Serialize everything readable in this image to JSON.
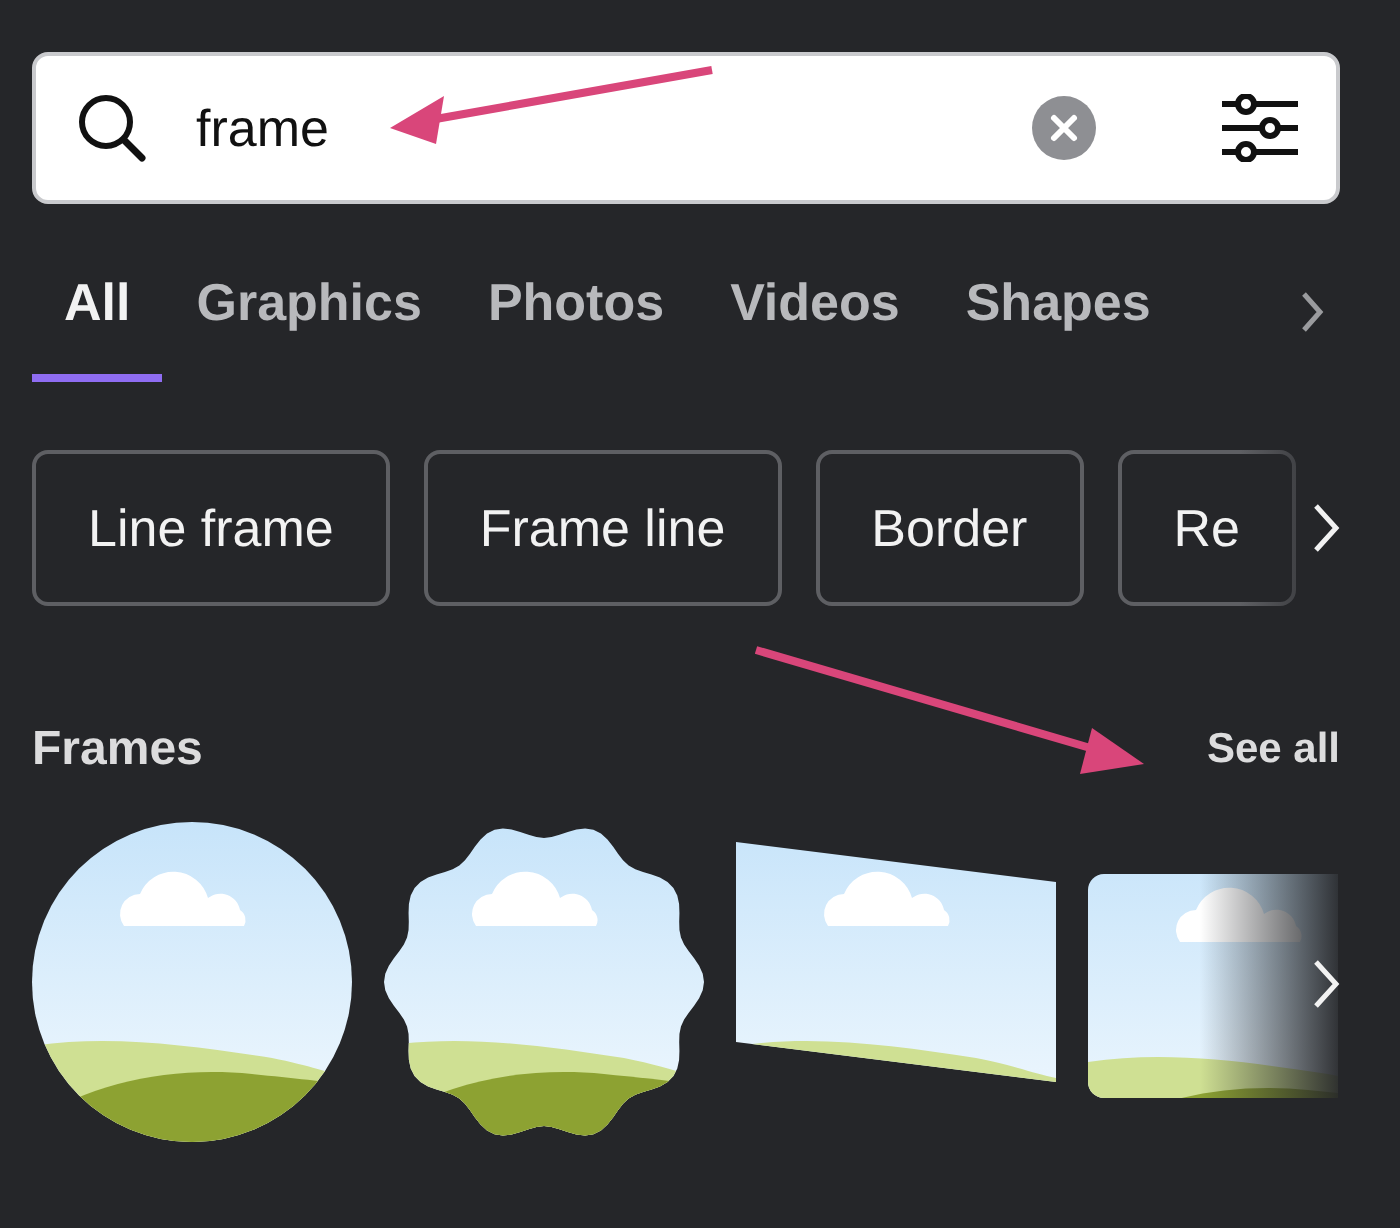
{
  "search": {
    "value": "frame"
  },
  "tabs": [
    {
      "label": "All",
      "selected": true
    },
    {
      "label": "Graphics",
      "selected": false
    },
    {
      "label": "Photos",
      "selected": false
    },
    {
      "label": "Videos",
      "selected": false
    },
    {
      "label": "Shapes",
      "selected": false
    }
  ],
  "chips": [
    "Line frame",
    "Frame line",
    "Border",
    "Re"
  ],
  "frames_section": {
    "title": "Frames",
    "link": "See all",
    "items": [
      {
        "kind": "circle"
      },
      {
        "kind": "scallop"
      },
      {
        "kind": "skewed"
      },
      {
        "kind": "rounded"
      }
    ]
  }
}
